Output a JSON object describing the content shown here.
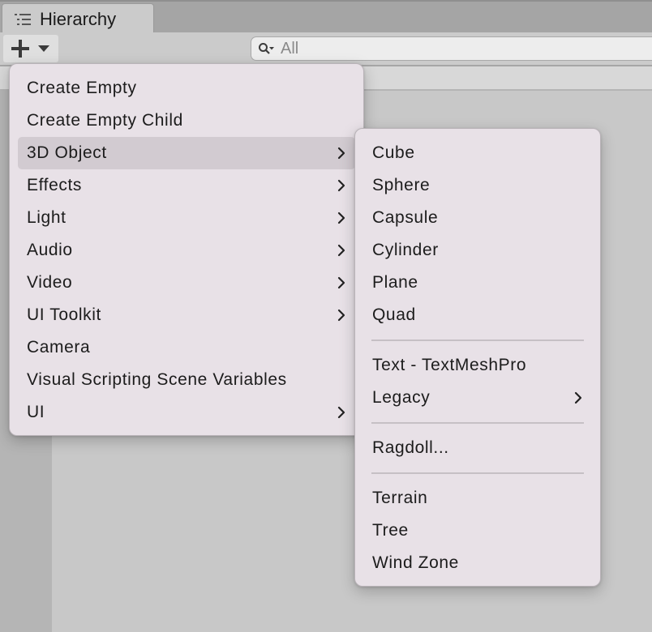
{
  "window": {
    "tab_title": "Hierarchy",
    "tab_icon": "list-icon"
  },
  "toolbar": {
    "add_icon": "plus-icon",
    "dropdown_icon": "caret-down-icon",
    "search": {
      "icon": "search-icon",
      "placeholder": "All"
    }
  },
  "create_menu": {
    "items": [
      {
        "label": "Create Empty",
        "submenu": false
      },
      {
        "label": "Create Empty Child",
        "submenu": false
      },
      {
        "label": "3D Object",
        "submenu": true,
        "highlighted": true
      },
      {
        "label": "Effects",
        "submenu": true
      },
      {
        "label": "Light",
        "submenu": true
      },
      {
        "label": "Audio",
        "submenu": true
      },
      {
        "label": "Video",
        "submenu": true
      },
      {
        "label": "UI Toolkit",
        "submenu": true
      },
      {
        "label": "Camera",
        "submenu": false
      },
      {
        "label": "Visual Scripting Scene Variables",
        "submenu": false
      },
      {
        "label": "UI",
        "submenu": true
      }
    ]
  },
  "object_submenu": {
    "items": [
      {
        "label": "Cube"
      },
      {
        "label": "Sphere"
      },
      {
        "label": "Capsule"
      },
      {
        "label": "Cylinder"
      },
      {
        "label": "Plane"
      },
      {
        "label": "Quad"
      },
      {
        "label": "Text - TextMeshPro"
      },
      {
        "label": "Legacy",
        "submenu": true
      },
      {
        "label": "Ragdoll..."
      },
      {
        "label": "Terrain"
      },
      {
        "label": "Tree"
      },
      {
        "label": "Wind Zone"
      }
    ]
  },
  "colors": {
    "menu_background": "#e8e1e7",
    "highlight": "#d2cbd1",
    "panel_background": "#c8c8c8"
  }
}
